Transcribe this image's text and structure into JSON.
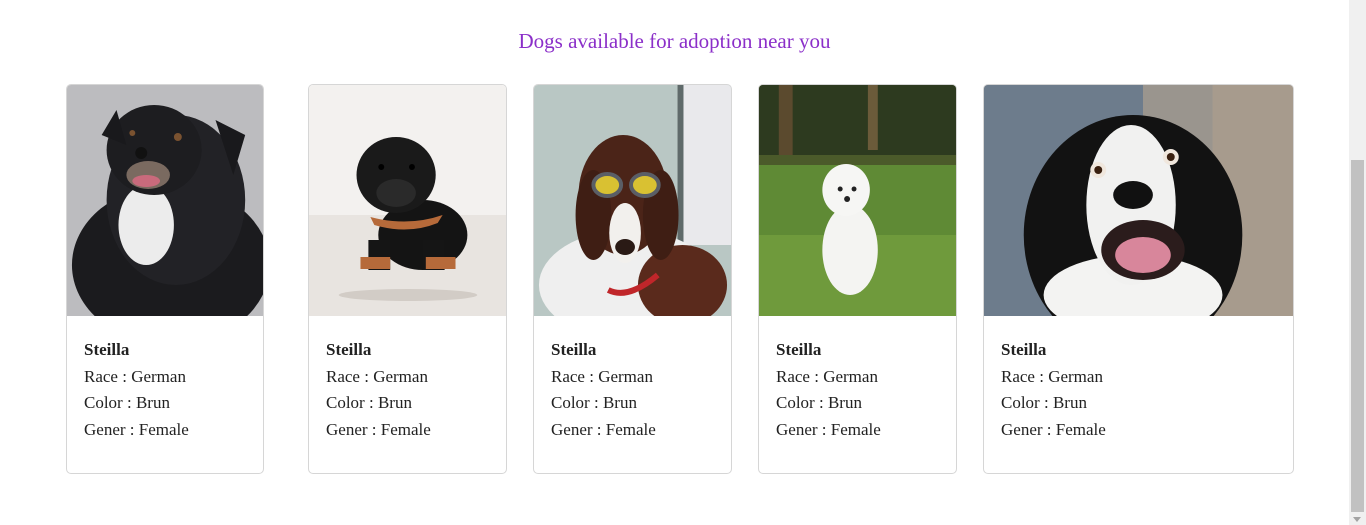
{
  "heading": "Dogs available for adoption near you",
  "cards": [
    {
      "name": "Steilla",
      "race": "Race : German",
      "color": "Color : Brun",
      "gender": "Gener : Female",
      "image": "black-collie-dog-photo"
    },
    {
      "name": "Steilla",
      "race": "Race : German",
      "color": "Color : Brun",
      "gender": "Gener : Female",
      "image": "dachshund-puppy-photo"
    },
    {
      "name": "Steilla",
      "race": "Race : German",
      "color": "Color : Brun",
      "gender": "Gener : Female",
      "image": "spaniel-with-goggles-photo"
    },
    {
      "name": "Steilla",
      "race": "Race : German",
      "color": "Color : Brun",
      "gender": "Gener : Female",
      "image": "white-maltese-grass-photo"
    },
    {
      "name": "Steilla",
      "race": "Race : German",
      "color": "Color : Brun",
      "gender": "Gener : Female",
      "image": "border-collie-closeup-photo"
    }
  ],
  "colors": {
    "heading": "#8b2fc9",
    "card_border": "#d6d6d6",
    "text": "#222222"
  }
}
